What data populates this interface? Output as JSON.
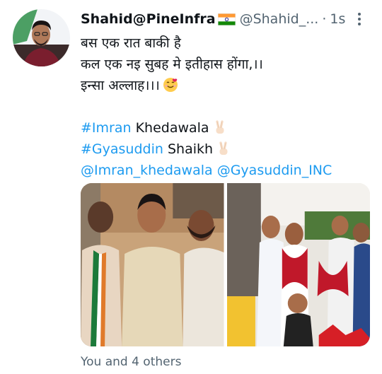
{
  "tweet": {
    "display_name": "Shahid@PineInfra",
    "flag_icon": "india-flag-icon",
    "handle": "@Shahid_...",
    "separator": "·",
    "time": "1s",
    "lines": [
      "बस एक रात बाकी है",
      "कल एक नइ सुबह मे इतीहास होंगा,।।",
      "इन्सा अल्लाह।।।"
    ],
    "hashtag1": "#Imran",
    "hashtag1_rest": " Khedawala",
    "hashtag2": "#Gyasuddin",
    "hashtag2_rest": " Shaikh",
    "mention1": "@Imran_khedawala",
    "mention2": "@Gyasuddin_INC",
    "tagged_text": "You and 4 others"
  },
  "colors": {
    "link": "#1d9bf0",
    "secondary_text": "#536471",
    "primary_text": "#0f1419"
  }
}
